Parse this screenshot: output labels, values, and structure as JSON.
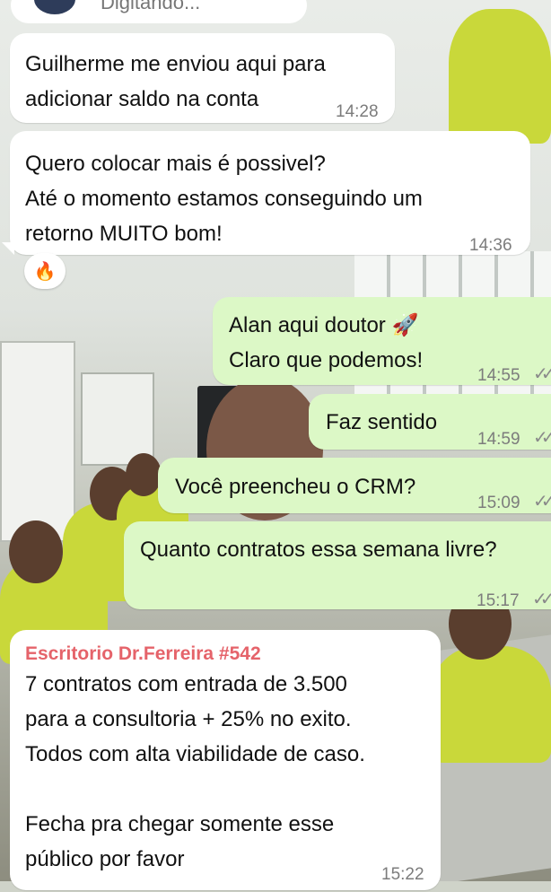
{
  "header": {
    "typing_text": "Digitando..."
  },
  "messages": [
    {
      "id": "m1",
      "direction": "in",
      "text": "Guilherme me enviou aqui para\nadicionar saldo na conta",
      "time": "14:28"
    },
    {
      "id": "m2",
      "direction": "in",
      "text": "Quero colocar mais é possivel?\nAté o momento estamos conseguindo um\nretorno MUITO bom!",
      "time": "14:36",
      "reaction": "🔥"
    },
    {
      "id": "m3",
      "direction": "out",
      "text": "Alan aqui doutor 🚀\nClaro que podemos!",
      "time": "14:55",
      "status": "read-checks"
    },
    {
      "id": "m4",
      "direction": "out",
      "text": "Faz sentido",
      "time": "14:59",
      "status": "read-checks"
    },
    {
      "id": "m5",
      "direction": "out",
      "text": "Você preencheu o CRM?",
      "time": "15:09",
      "status": "read-checks"
    },
    {
      "id": "m6",
      "direction": "out",
      "text": "Quanto contratos essa semana livre?",
      "time": "15:17",
      "status": "read-checks"
    },
    {
      "id": "m7",
      "direction": "in",
      "sender": "Escritorio Dr.Ferreira #542",
      "text": "7 contratos com entrada de 3.500\npara a consultoria + 25% no exito.\nTodos com alta viabilidade de caso.\n\nFecha pra chegar somente esse\npúblico por favor",
      "time": "15:22"
    }
  ],
  "colors": {
    "incoming": "#ffffff",
    "outgoing": "#dcf8c6",
    "sender": "#e5636a"
  },
  "check_glyph": "✓✓"
}
